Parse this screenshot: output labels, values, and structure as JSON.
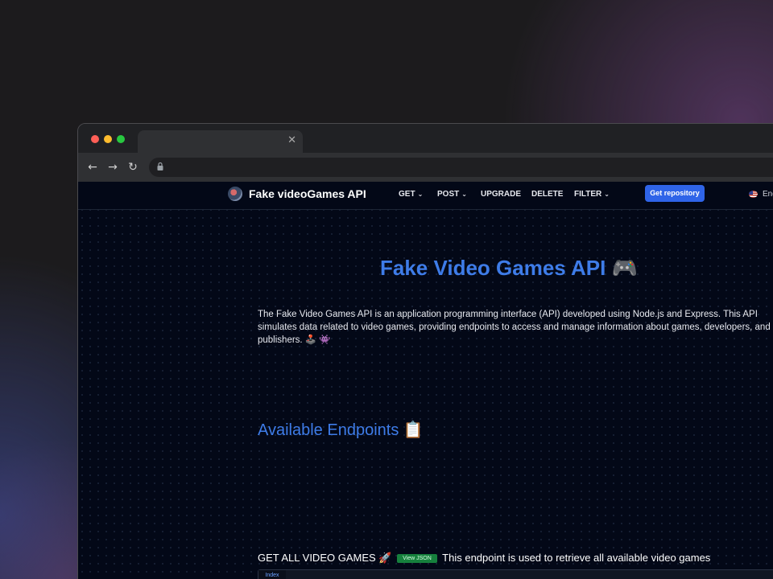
{
  "browser": {
    "tab_close_glyph": "✕",
    "back_glyph": "←",
    "forward_glyph": "→",
    "reload_glyph": "↻"
  },
  "nav": {
    "brand": "Fake videoGames API",
    "items": [
      {
        "label": "GET",
        "has_dropdown": true
      },
      {
        "label": "POST",
        "has_dropdown": true
      },
      {
        "label": "UPGRADE",
        "has_dropdown": false
      },
      {
        "label": "DELETE",
        "has_dropdown": false
      },
      {
        "label": "FILTER",
        "has_dropdown": true
      }
    ],
    "chevron_glyph": "⌄",
    "cta_label": "Get repository",
    "language": "Eng"
  },
  "hero": {
    "title": "Fake Video Games API",
    "title_emoji": "🎮",
    "description": "The Fake Video Games API is an application programming interface (API) developed using Node.js and Express. This API simulates data related to video games, providing endpoints to access and manage information about games, developers, and publishers. 🕹️ 👾"
  },
  "endpoints": {
    "section_title": "Available Endpoints",
    "section_emoji": "📋",
    "items": [
      {
        "name": "GET ALL VIDEO GAMES",
        "emoji": "🚀",
        "button_label": "View JSON",
        "description": "This endpoint is used to retrieve all available video games",
        "code_tab": "Index"
      }
    ]
  },
  "colors": {
    "accent": "#3e7ce8",
    "cta": "#2f64e8",
    "badge": "#16803d",
    "page_bg": "#030817"
  }
}
